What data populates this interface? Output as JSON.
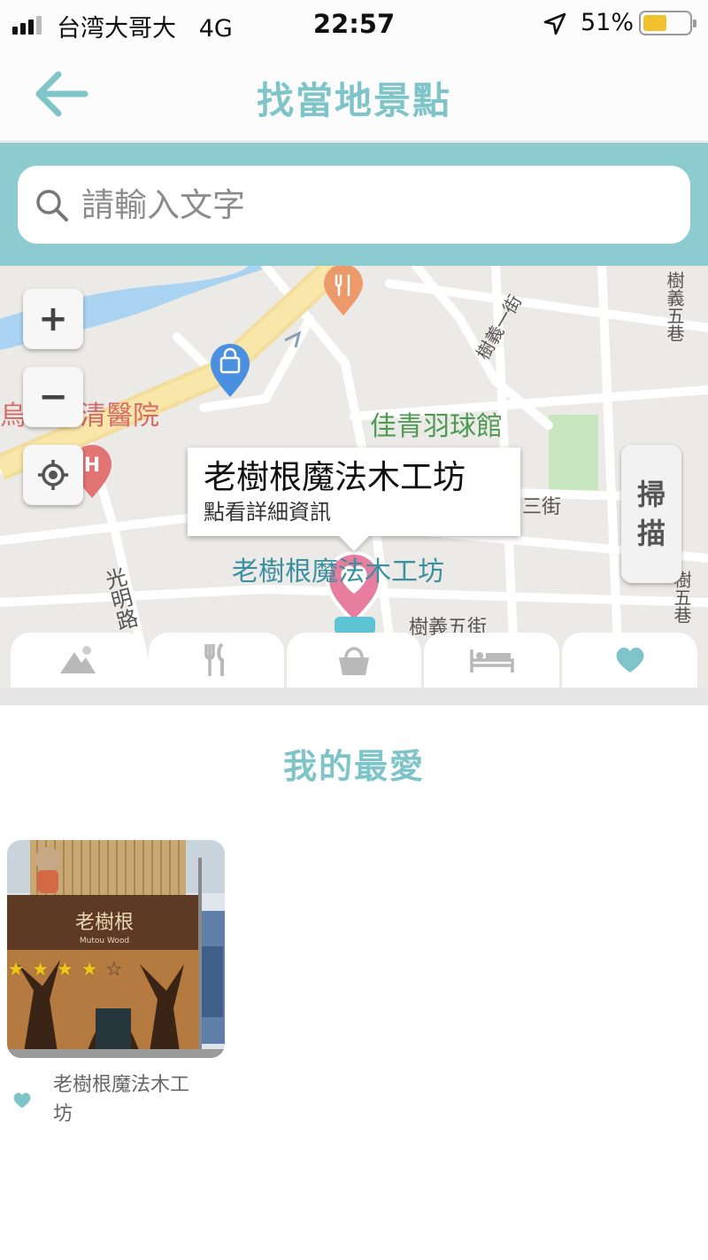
{
  "status_bar": {
    "carrier": "台湾大哥大",
    "network": "4G",
    "time": "22:57",
    "battery": "51%",
    "battery_level": 0.51
  },
  "header": {
    "title": "找當地景點",
    "back_icon": "arrow-left-icon"
  },
  "search": {
    "placeholder": "請輸入文字",
    "value": ""
  },
  "map": {
    "zoom_in_label": "+",
    "zoom_out_label": "−",
    "scan_label_top": "掃",
    "scan_label_bottom": "描",
    "callout": {
      "title": "老樹根魔法木工坊",
      "subtitle": "點看詳細資訊"
    },
    "labels": {
      "hospital": "烏日澄清醫院",
      "badminton": "佳青羽球館",
      "marker_name": "老樹根魔法木工坊",
      "road_guangming": "光明路",
      "street_shuyi5": "樹義五街",
      "street_shuyi1": "樹義一街",
      "street_shuyi5_top": "樹義五巷",
      "street_3": "三街",
      "street_edge": "樹五巷"
    }
  },
  "tabs": [
    {
      "name": "scenery",
      "icon": "mountain-icon"
    },
    {
      "name": "food",
      "icon": "utensils-icon"
    },
    {
      "name": "shopping",
      "icon": "shopping-bag-icon"
    },
    {
      "name": "lodging",
      "icon": "bed-icon"
    },
    {
      "name": "favorites",
      "icon": "heart-icon",
      "active": true
    }
  ],
  "favorites": {
    "section_title": "我的最愛",
    "items": [
      {
        "name": "老樹根魔法木工坊",
        "rating": 4,
        "max_rating": 5,
        "sign_text": "老樹根",
        "sign_sub": "Mutou Wood"
      }
    ]
  },
  "colors": {
    "accent": "#7ec4c8",
    "search_band": "#8ccbd0",
    "star": "#f2c619"
  }
}
